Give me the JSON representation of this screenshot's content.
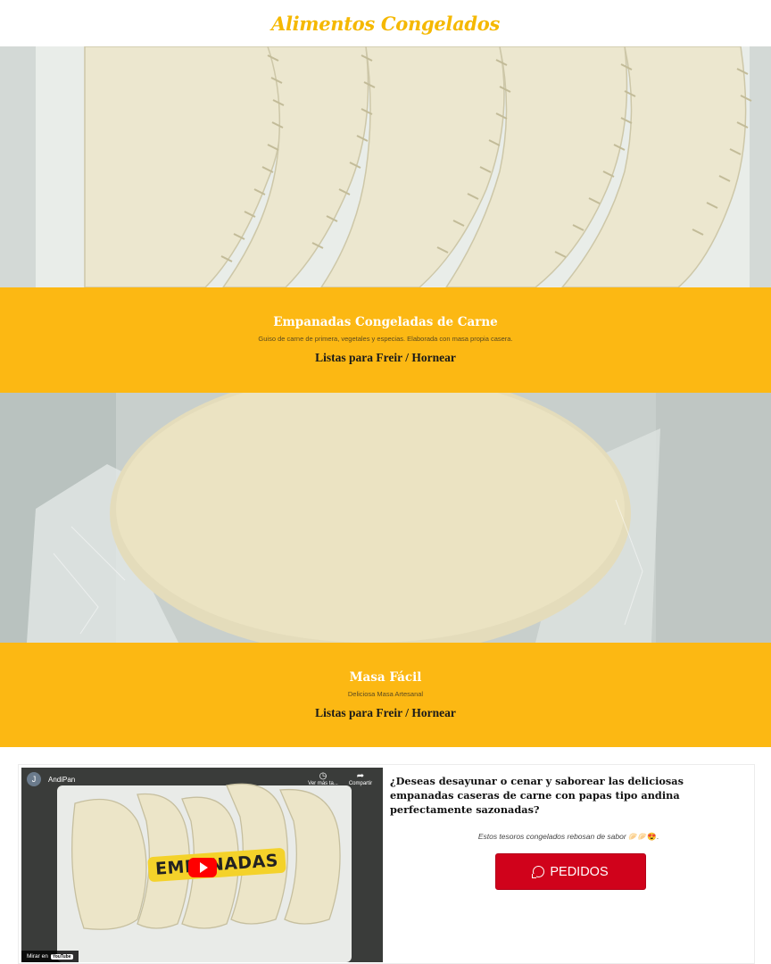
{
  "header": {
    "title": "Alimentos Congelados"
  },
  "products": [
    {
      "image_icon": "empanadas-photo",
      "title": "Empanadas Congeladas de Carne",
      "description": "Guiso de carne de primera, vegetales y especias. Elaborada con masa propia casera.",
      "cta": "Listas para Freir / Hornear"
    },
    {
      "image_icon": "dough-disc-photo",
      "title": "Masa Fácil",
      "description": "Deliciosa Masa Artesanal",
      "cta": "Listas para Freir / Hornear"
    }
  ],
  "video": {
    "channel_initial": "J",
    "channel_name": "AndiPan",
    "watch_later": "Ver más ta...",
    "share": "Compartir",
    "overlay_text": "EMPANADAS",
    "watch_on": "Mirar en",
    "platform": "YouTube"
  },
  "promo": {
    "question": "¿Deseas desayunar o cenar y saborear las deliciosas empanadas caseras de carne con papas tipo andina perfectamente sazonadas?",
    "subtitle": "Estos tesoros congelados rebosan de sabor",
    "subtitle_emojis": "🥟🥟😍.",
    "button_label": "PEDIDOS",
    "button_icon": "whatsapp-icon"
  },
  "colors": {
    "accent": "#fcb813",
    "title_gold": "#f5b800",
    "button_red": "#d0021b"
  }
}
